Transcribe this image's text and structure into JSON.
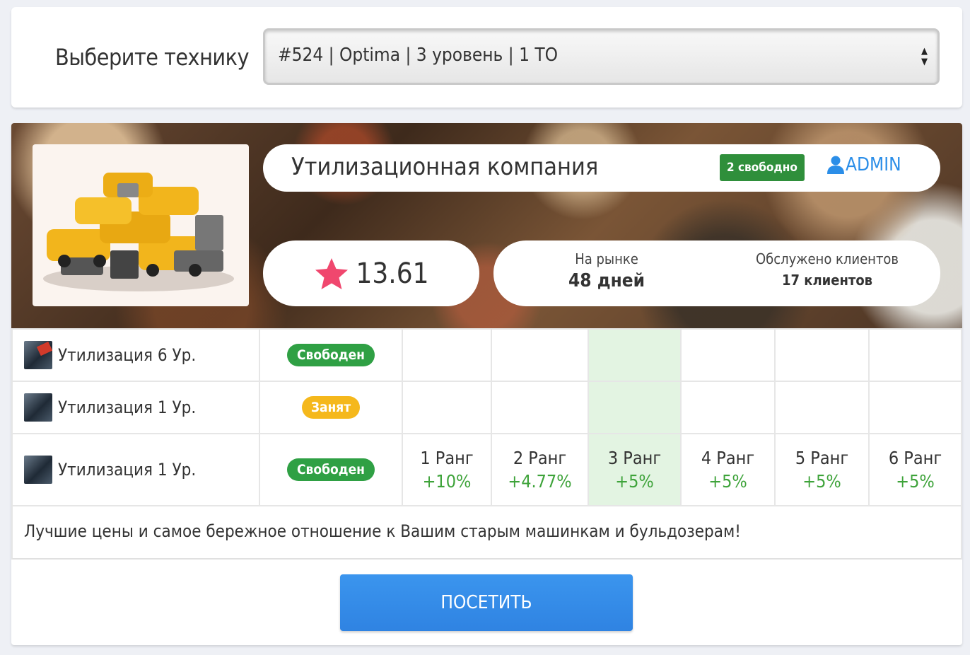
{
  "selector": {
    "label": "Выберите технику",
    "selected": "#524 | Optima | 3 уровень | 1 ТО"
  },
  "company": {
    "name": "Утилизационная компания",
    "free_badge": "2 свободно",
    "owner": "ADMIN",
    "rating": "13.61",
    "market_label": "На рынке",
    "market_value": "48 дней",
    "clients_label": "Обслужено клиентов",
    "clients_value": "17 клиентов",
    "description": "Лучшие цены и самое бережное отношение к Вашим старым машинкам и бульдозерам!"
  },
  "services": [
    {
      "name": "Утилизация 6 Ур.",
      "status": "Свободен"
    },
    {
      "name": "Утилизация 1 Ур.",
      "status": "Занят"
    },
    {
      "name": "Утилизация 1 Ур.",
      "status": "Свободен"
    }
  ],
  "ranks": [
    {
      "title": "1 Ранг",
      "bonus": "+10%"
    },
    {
      "title": "2 Ранг",
      "bonus": "+4.77%"
    },
    {
      "title": "3 Ранг",
      "bonus": "+5%"
    },
    {
      "title": "4 Ранг",
      "bonus": "+5%"
    },
    {
      "title": "5 Ранг",
      "bonus": "+5%"
    },
    {
      "title": "6 Ранг",
      "bonus": "+5%"
    }
  ],
  "highlighted_rank": 3,
  "visit_label": "ПОСЕТИТЬ",
  "colors": {
    "accent": "#2f83e2",
    "free": "#2fa044",
    "busy": "#f5b81c",
    "bonus": "#3ea33a",
    "star": "#f0476e"
  },
  "icons": {
    "star": "star-icon",
    "user": "user-icon",
    "select_arrows": "select-arrows-icon"
  }
}
